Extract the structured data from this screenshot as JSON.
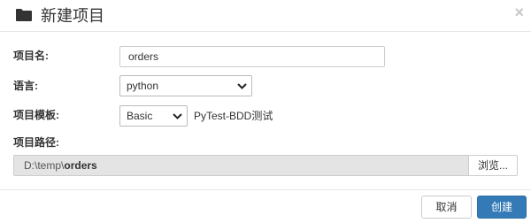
{
  "dialog": {
    "title": "新建项目",
    "close_symbol": "×",
    "icons": {
      "title": "folder-icon",
      "close": "close-icon",
      "select": "chevron-down-icon"
    }
  },
  "form": {
    "name_label": "项目名:",
    "name_value": "orders",
    "language_label": "语言:",
    "language_value": "python",
    "template_label": "项目模板:",
    "template_value": "Basic",
    "template_desc": "PyTest-BDD测试",
    "path_label": "项目路径:",
    "path_prefix": "D:\\temp\\",
    "path_name": "orders",
    "browse_label": "浏览..."
  },
  "footer": {
    "cancel_label": "取消",
    "create_label": "创建"
  },
  "colors": {
    "primary": "#337ab7",
    "path_background": "#e4e4e4"
  }
}
